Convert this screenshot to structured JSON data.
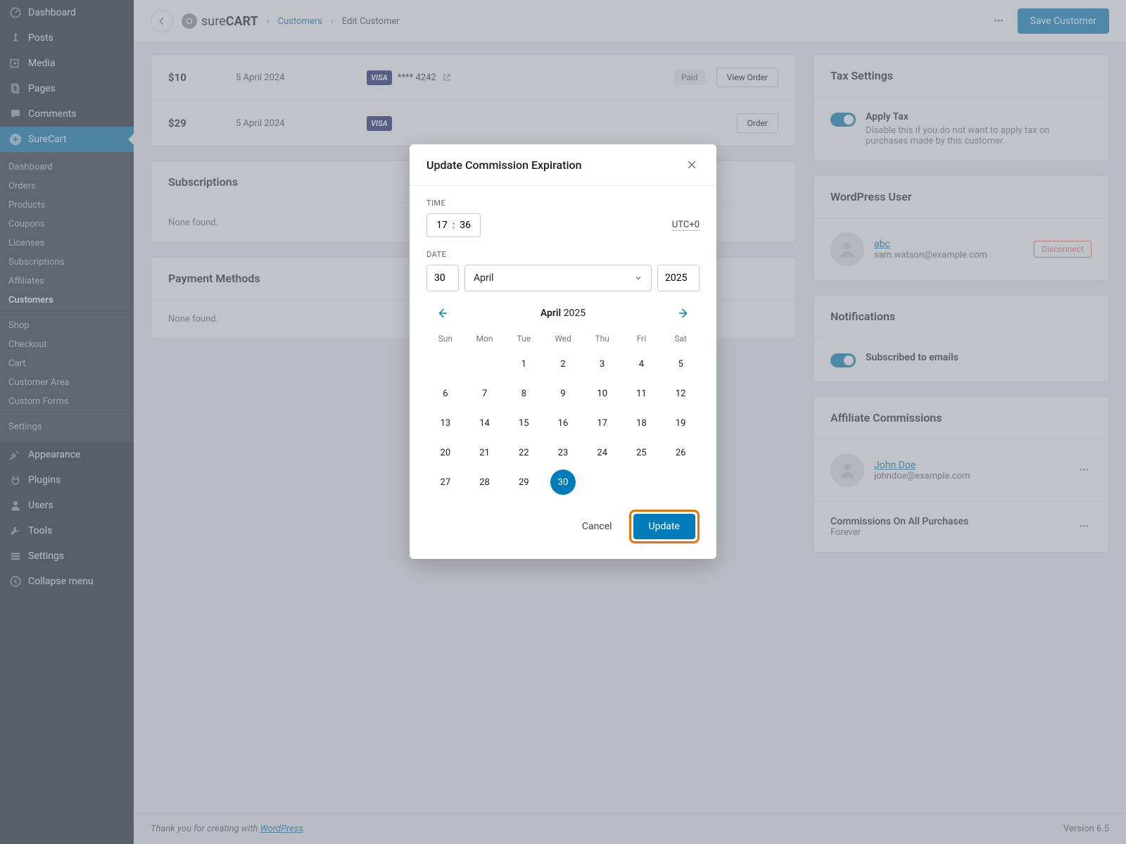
{
  "sidebar": {
    "main_items": [
      {
        "label": "Dashboard",
        "icon": "dashboard"
      },
      {
        "label": "Posts",
        "icon": "pin"
      },
      {
        "label": "Media",
        "icon": "media"
      },
      {
        "label": "Pages",
        "icon": "pages"
      },
      {
        "label": "Comments",
        "icon": "comments"
      }
    ],
    "surecart_label": "SureCart",
    "surecart_sub": [
      "Dashboard",
      "Orders",
      "Products",
      "Coupons",
      "Licenses",
      "Subscriptions",
      "Affiliates",
      "Customers",
      "Shop",
      "Checkout",
      "Cart",
      "Customer Area",
      "Custom Forms",
      "Settings"
    ],
    "bottom_items": [
      {
        "label": "Appearance",
        "icon": "appearance"
      },
      {
        "label": "Plugins",
        "icon": "plugins"
      },
      {
        "label": "Users",
        "icon": "users"
      },
      {
        "label": "Tools",
        "icon": "tools"
      },
      {
        "label": "Settings",
        "icon": "settings"
      },
      {
        "label": "Collapse menu",
        "icon": "collapse"
      }
    ]
  },
  "topbar": {
    "brand_pre": "sure",
    "brand_bold": "CART",
    "crumb1": "Customers",
    "crumb2": "Edit Customer",
    "save_label": "Save Customer"
  },
  "orders": [
    {
      "amount": "$10",
      "date": "5 April 2024",
      "card": "**** 4242",
      "status": "Paid",
      "view": "View Order"
    },
    {
      "amount": "$29",
      "date": "5 April 2024",
      "card": "",
      "status": "",
      "view": "Order"
    }
  ],
  "sections": {
    "subscriptions_title": "Subscriptions",
    "none_found": "None found.",
    "payment_methods_title": "Payment Methods"
  },
  "right": {
    "tax_title": "Tax Settings",
    "apply_tax_label": "Apply Tax",
    "apply_tax_help": "Disable this if you do not want to apply tax on purchases made by this customer.",
    "wp_user_title": "WordPress User",
    "wp_user_name": "abc",
    "wp_user_email": "sam.watson@example.com",
    "disconnect": "Disconnect",
    "notifications_title": "Notifications",
    "subscribed_label": "Subscribed to emails",
    "aff_title": "Affiliate Commissions",
    "aff_name": "John Doe",
    "aff_email": "johndoe@example.com",
    "aff_all_label": "Commissions On All Purchases",
    "aff_all_value": "Forever"
  },
  "footer": {
    "thanks_pre": "Thank you for creating with ",
    "wp": "WordPress",
    "version": "Version 6.5"
  },
  "modal": {
    "title": "Update Commission Expiration",
    "time_label": "TIME",
    "hour": "17",
    "minute": "36",
    "tz": "UTC+0",
    "date_label": "DATE",
    "day": "30",
    "month": "April",
    "year": "2025",
    "cal_month": "April",
    "cal_year": "2025",
    "dow": [
      "Sun",
      "Mon",
      "Tue",
      "Wed",
      "Thu",
      "Fri",
      "Sat"
    ],
    "selected_day": 30,
    "first_weekday": 2,
    "days_in_month": 30,
    "cancel": "Cancel",
    "update": "Update"
  }
}
